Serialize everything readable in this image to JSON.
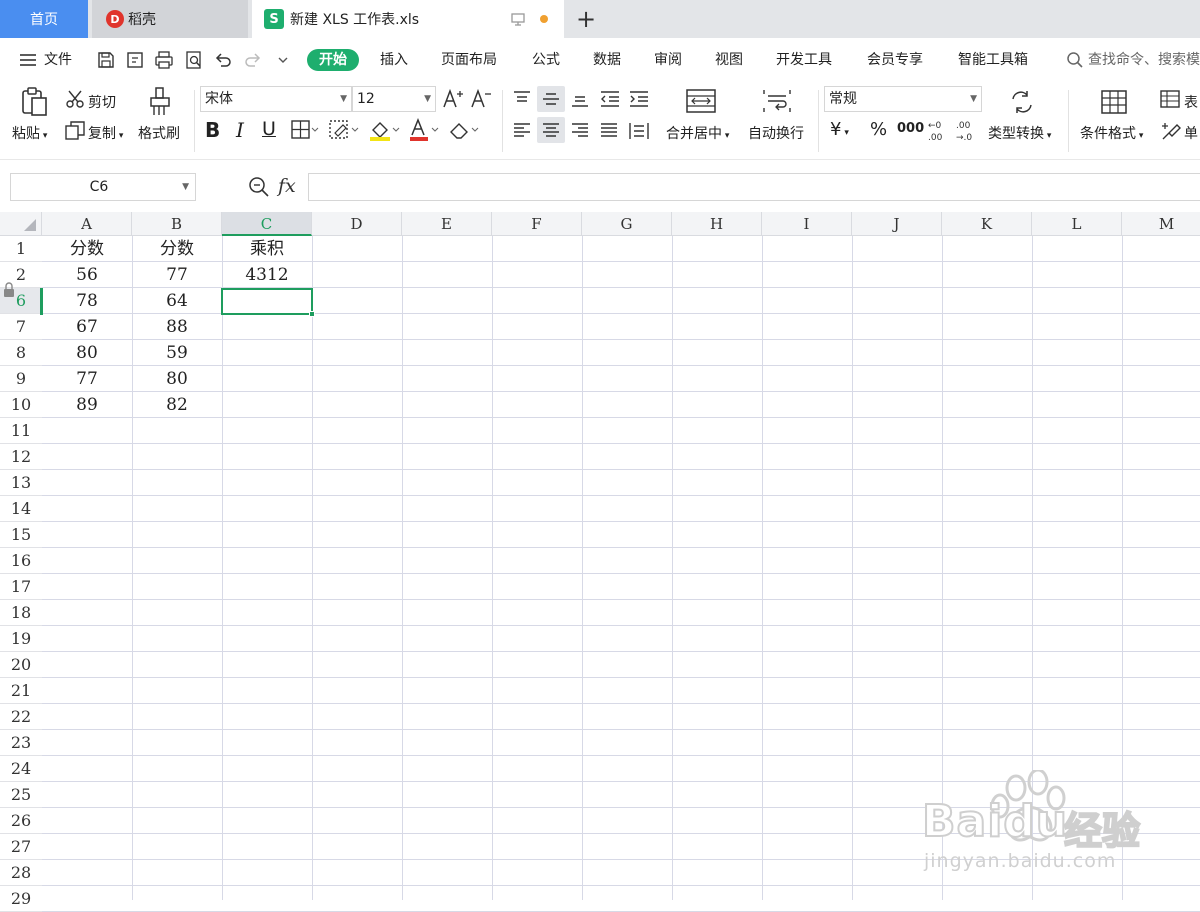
{
  "tabs": {
    "home": "首页",
    "daoke": "稻壳",
    "file": "新建 XLS 工作表.xls",
    "file_icon": "S",
    "add": "+"
  },
  "menu": {
    "file": "文件",
    "items": [
      "开始",
      "插入",
      "页面布局",
      "公式",
      "数据",
      "审阅",
      "视图",
      "开发工具",
      "会员专享",
      "智能工具箱"
    ],
    "search": "查找命令、搜索模"
  },
  "ribbon": {
    "paste": "粘贴",
    "cut": "剪切",
    "copy": "复制",
    "format_painter": "格式刷",
    "font_name": "宋体",
    "font_size": "12",
    "merge_center": "合并居中",
    "wrap_text": "自动换行",
    "number_format": "常规",
    "currency": "¥",
    "percent": "%",
    "thousands": "000",
    "type_convert": "类型转换",
    "cond_format": "条件格式",
    "table_style": "表",
    "cell": "单"
  },
  "formula_bar": {
    "name_box": "C6",
    "fx": "fx",
    "value": ""
  },
  "grid": {
    "columns": [
      "A",
      "B",
      "C",
      "D",
      "E",
      "F",
      "G",
      "H",
      "I",
      "J",
      "K",
      "L",
      "M"
    ],
    "rows": [
      "1",
      "2",
      "6",
      "7",
      "8",
      "9",
      "10",
      "11",
      "12",
      "13",
      "14",
      "15",
      "16",
      "17",
      "18",
      "19",
      "20",
      "21",
      "22",
      "23",
      "24",
      "25",
      "26",
      "27",
      "28",
      "29"
    ],
    "data": [
      [
        "分数",
        "分数",
        "乘积"
      ],
      [
        "56",
        "77",
        "4312"
      ],
      [
        "78",
        "64",
        ""
      ],
      [
        "67",
        "88",
        ""
      ],
      [
        "80",
        "59",
        ""
      ],
      [
        "77",
        "80",
        ""
      ],
      [
        "89",
        "82",
        ""
      ]
    ],
    "selected_cell": "C6"
  },
  "watermark": {
    "brand": "Baidu",
    "brand_cn": "经验",
    "url": "jingyan.baidu.com"
  },
  "colors": {
    "accent": "#1eae6e",
    "home_tab": "#4a8ef0",
    "selection": "#1e9d5e"
  }
}
